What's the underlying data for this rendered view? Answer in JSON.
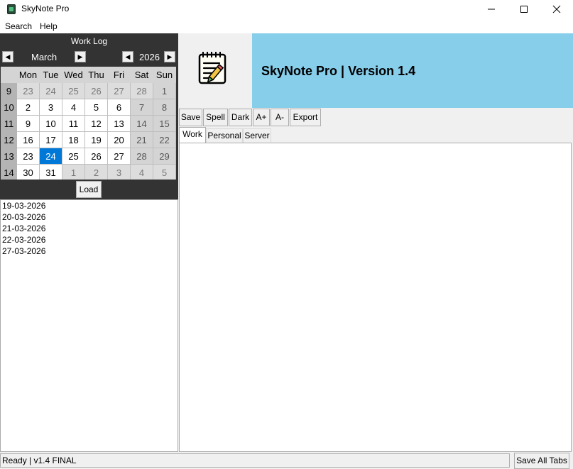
{
  "window": {
    "title": "SkyNote Pro"
  },
  "menu": {
    "items": [
      "Search",
      "Help"
    ]
  },
  "calendar": {
    "header": "Work Log",
    "month": "March",
    "year": "2026",
    "weekday_headers": [
      "Mon",
      "Tue",
      "Wed",
      "Thu",
      "Fri",
      "Sat",
      "Sun"
    ],
    "weeks": [
      {
        "week": "9",
        "days": [
          "23",
          "24",
          "25",
          "26",
          "27",
          "28",
          "1"
        ]
      },
      {
        "week": "10",
        "days": [
          "2",
          "3",
          "4",
          "5",
          "6",
          "7",
          "8"
        ]
      },
      {
        "week": "11",
        "days": [
          "9",
          "10",
          "11",
          "12",
          "13",
          "14",
          "15"
        ]
      },
      {
        "week": "12",
        "days": [
          "16",
          "17",
          "18",
          "19",
          "20",
          "21",
          "22"
        ]
      },
      {
        "week": "13",
        "days": [
          "23",
          "24",
          "25",
          "26",
          "27",
          "28",
          "29"
        ]
      },
      {
        "week": "14",
        "days": [
          "30",
          "31",
          "1",
          "2",
          "3",
          "4",
          "5"
        ]
      }
    ],
    "selected_day": "24",
    "selection_color": "#0078d7"
  },
  "load_label": "Load",
  "files": [
    "19-03-2026",
    "20-03-2026",
    "21-03-2026",
    "22-03-2026",
    "27-03-2026"
  ],
  "banner": {
    "title": "SkyNote Pro | Version 1.4",
    "color": "#87ceeb",
    "icon": "notepad-pencil-icon"
  },
  "toolbar": {
    "save": "Save",
    "spell": "Spell",
    "dark": "Dark",
    "font_up": "A+",
    "font_down": "A-",
    "export": "Export"
  },
  "tabs": [
    "Work",
    "Personal",
    "Server"
  ],
  "status": {
    "text": "Ready | v1.4 FINAL",
    "save_all": "Save All Tabs"
  }
}
